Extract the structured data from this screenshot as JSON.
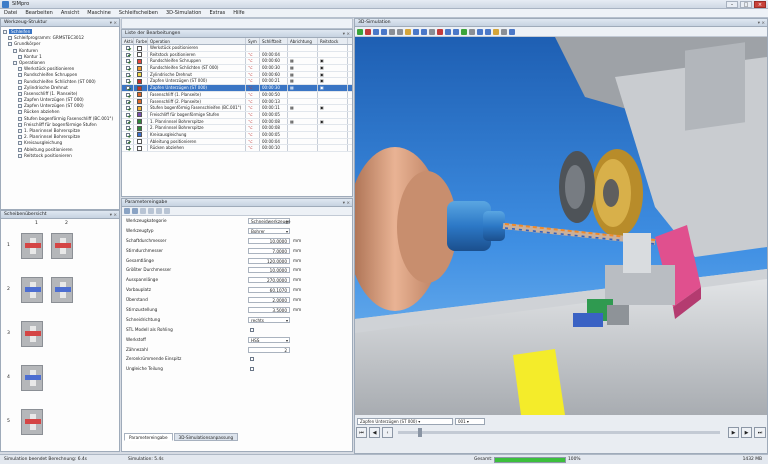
{
  "app": {
    "title": "SIMpro"
  },
  "menu": [
    "Datei",
    "Bearbeiten",
    "Ansicht",
    "Maschine",
    "Schleifscheiben",
    "3D-Simulation",
    "Extras",
    "Hilfe"
  ],
  "tree": {
    "title": "Werkzeug-Struktur",
    "items": [
      {
        "label": "Schleifen",
        "indent": 0
      },
      {
        "label": "Schleifprogramm: GRMSTEC3012",
        "indent": 1
      },
      {
        "label": "Grundkörper",
        "indent": 1
      },
      {
        "label": "Konturen",
        "indent": 2
      },
      {
        "label": "Kontur 1",
        "indent": 3
      },
      {
        "label": "Operationen",
        "indent": 2
      },
      {
        "label": "Werkstück positionieren",
        "indent": 3
      },
      {
        "label": "Rundschleifen Schruppen",
        "indent": 3
      },
      {
        "label": "Rundschleifen Schlichten (ST 000)",
        "indent": 3
      },
      {
        "label": "Zylindrische Drehnut",
        "indent": 3
      },
      {
        "label": "Fasenschliff (1. Planseite)",
        "indent": 3
      },
      {
        "label": "Zapfen Unterzügen (ST 000)",
        "indent": 3
      },
      {
        "label": "Zapfen Unterzügen (ST 000)",
        "indent": 3
      },
      {
        "label": "Rücken abziehen",
        "indent": 3
      },
      {
        "label": "Stufen bogenförmig Fasenschliff (BC.001°)",
        "indent": 3
      },
      {
        "label": "Freischliff für bogenförmige Stufen",
        "indent": 3
      },
      {
        "label": "1. Planrinnsel Bohrerspitze",
        "indent": 3
      },
      {
        "label": "2. Planrinnsel Bohrerspitze",
        "indent": 3
      },
      {
        "label": "Kreisausgleichung",
        "indent": 3
      },
      {
        "label": "Ableitung positionieren",
        "indent": 3
      },
      {
        "label": "Reitstock positionieren",
        "indent": 3
      }
    ]
  },
  "wheels": {
    "title": "Scheibenübersicht",
    "cols": [
      "1",
      "2"
    ],
    "rows": [
      "1",
      "2",
      "3",
      "4",
      "5"
    ]
  },
  "ops": {
    "title": "Liste der Bearbeitungen",
    "columns": [
      "Aktiv",
      "Farbe",
      "Operation",
      "Sym",
      "Schliffzeit",
      "Abrichtung",
      "Reitstock"
    ],
    "rows": [
      {
        "name": "Werkstück positionieren",
        "color": "#ffffff",
        "time": "",
        "icon": false
      },
      {
        "name": "Reitstock positionieren",
        "color": "#ffffff",
        "time": "00:00:04",
        "icon": false
      },
      {
        "name": "Rundschleifen Schruppen",
        "color": "#e8463c",
        "time": "00:00:60",
        "icon": true
      },
      {
        "name": "Rundschleifen Schlichten (ST 000)",
        "color": "#f29a2e",
        "time": "00:00:30",
        "icon": true
      },
      {
        "name": "Zylindrische Drehnut",
        "color": "#f0d84a",
        "time": "00:00:60",
        "icon": true
      },
      {
        "name": "Zapfen Unterzügen (ST 000)",
        "color": "#c8302a",
        "time": "00:00:21",
        "icon": true
      },
      {
        "name": "Zapfen Unterzügen (ST 000)",
        "color": "#c8302a",
        "time": "00:00:30",
        "icon": true
      },
      {
        "name": "Fasenschliff (1. Planseite)",
        "color": "#e06a2a",
        "time": "00:00:50",
        "icon": false
      },
      {
        "name": "Fasenschliff (2. Planseite)",
        "color": "#e06a2a",
        "time": "00:00:13",
        "icon": false
      },
      {
        "name": "Stufen bogenförmig Fasenschleifen (BC.001°)",
        "color": "#f5b73a",
        "time": "00:00:11",
        "icon": true
      },
      {
        "name": "Freischliff für bogenförmige Stufen",
        "color": "#7a4fb2",
        "time": "00:00:05",
        "icon": false
      },
      {
        "name": "1. Planrinnsel Bohrerspitze",
        "color": "#2f8a3c",
        "time": "00:00:08",
        "icon": true
      },
      {
        "name": "2. Planrinnsel Bohrerspitze",
        "color": "#2f8a3c",
        "time": "00:00:08",
        "icon": false
      },
      {
        "name": "Kreisausgleichung",
        "color": "#3a6fd0",
        "time": "00:00:05",
        "icon": false
      },
      {
        "name": "Ableitung positionieren",
        "color": "#ffffff",
        "time": "00:00:04",
        "icon": false
      },
      {
        "name": "Rücken abziehen",
        "color": "#ffffff",
        "time": "00:00:10",
        "icon": false
      }
    ],
    "selected_index": 6
  },
  "params": {
    "title": "Parametereingabe",
    "rows": [
      {
        "label": "Werkzeugkategorie",
        "type": "dd",
        "value": "Schneidwerkzeuge"
      },
      {
        "label": "Werkzeugtyp",
        "type": "dd",
        "value": "Bohrer"
      },
      {
        "label": "Schaftdurchmesser",
        "type": "num",
        "value": "10.0000",
        "unit": "mm"
      },
      {
        "label": "Stirndurchmesser",
        "type": "num",
        "value": "7.0000",
        "unit": "mm"
      },
      {
        "label": "Gesamtlänge",
        "type": "num",
        "value": "120.0000",
        "unit": "mm"
      },
      {
        "label": "Größter Durchmesser",
        "type": "num",
        "value": "10.0000",
        "unit": "mm"
      },
      {
        "label": "Ausspannlänge",
        "type": "num",
        "value": "270.0000",
        "unit": "mm"
      },
      {
        "label": "Vorbauplatz",
        "type": "num",
        "value": "60.1070",
        "unit": "mm"
      },
      {
        "label": "Überstand",
        "type": "num",
        "value": "2.0000",
        "unit": "mm"
      },
      {
        "label": "Stirnzustellung",
        "type": "num",
        "value": "3.5000",
        "unit": "mm"
      },
      {
        "label": "Schneidrichtung",
        "type": "dd",
        "value": "rechts"
      },
      {
        "label": "STL Modell als Rohling",
        "type": "chk",
        "value": ""
      },
      {
        "label": "Werkstoff",
        "type": "dd",
        "value": "HSS"
      },
      {
        "label": "Zähnezahl",
        "type": "num",
        "value": "2",
        "unit": ""
      },
      {
        "label": "Zeronkrümmende Einspitz",
        "type": "chk",
        "value": ""
      },
      {
        "label": "Ungleiche Teilung",
        "type": "chk",
        "value": ""
      }
    ],
    "tabs": [
      "Parametereingabe",
      "3D-Simulationsanpassung"
    ]
  },
  "sim": {
    "title": "3D-Simulation",
    "op_select": "Zapfen Unterzügen (ST 000)",
    "step_select": "001"
  },
  "status": {
    "left": "Simulation beendet  Berechnung: 6.4s",
    "mid": "Simulation: 5.4s",
    "progress_label": "Gesamt:",
    "progress_value": 100,
    "progress_text": "100%",
    "memory": "1432 MB"
  },
  "colors": {
    "accent": "#3a75c4",
    "progress": "#3cbf3c"
  }
}
